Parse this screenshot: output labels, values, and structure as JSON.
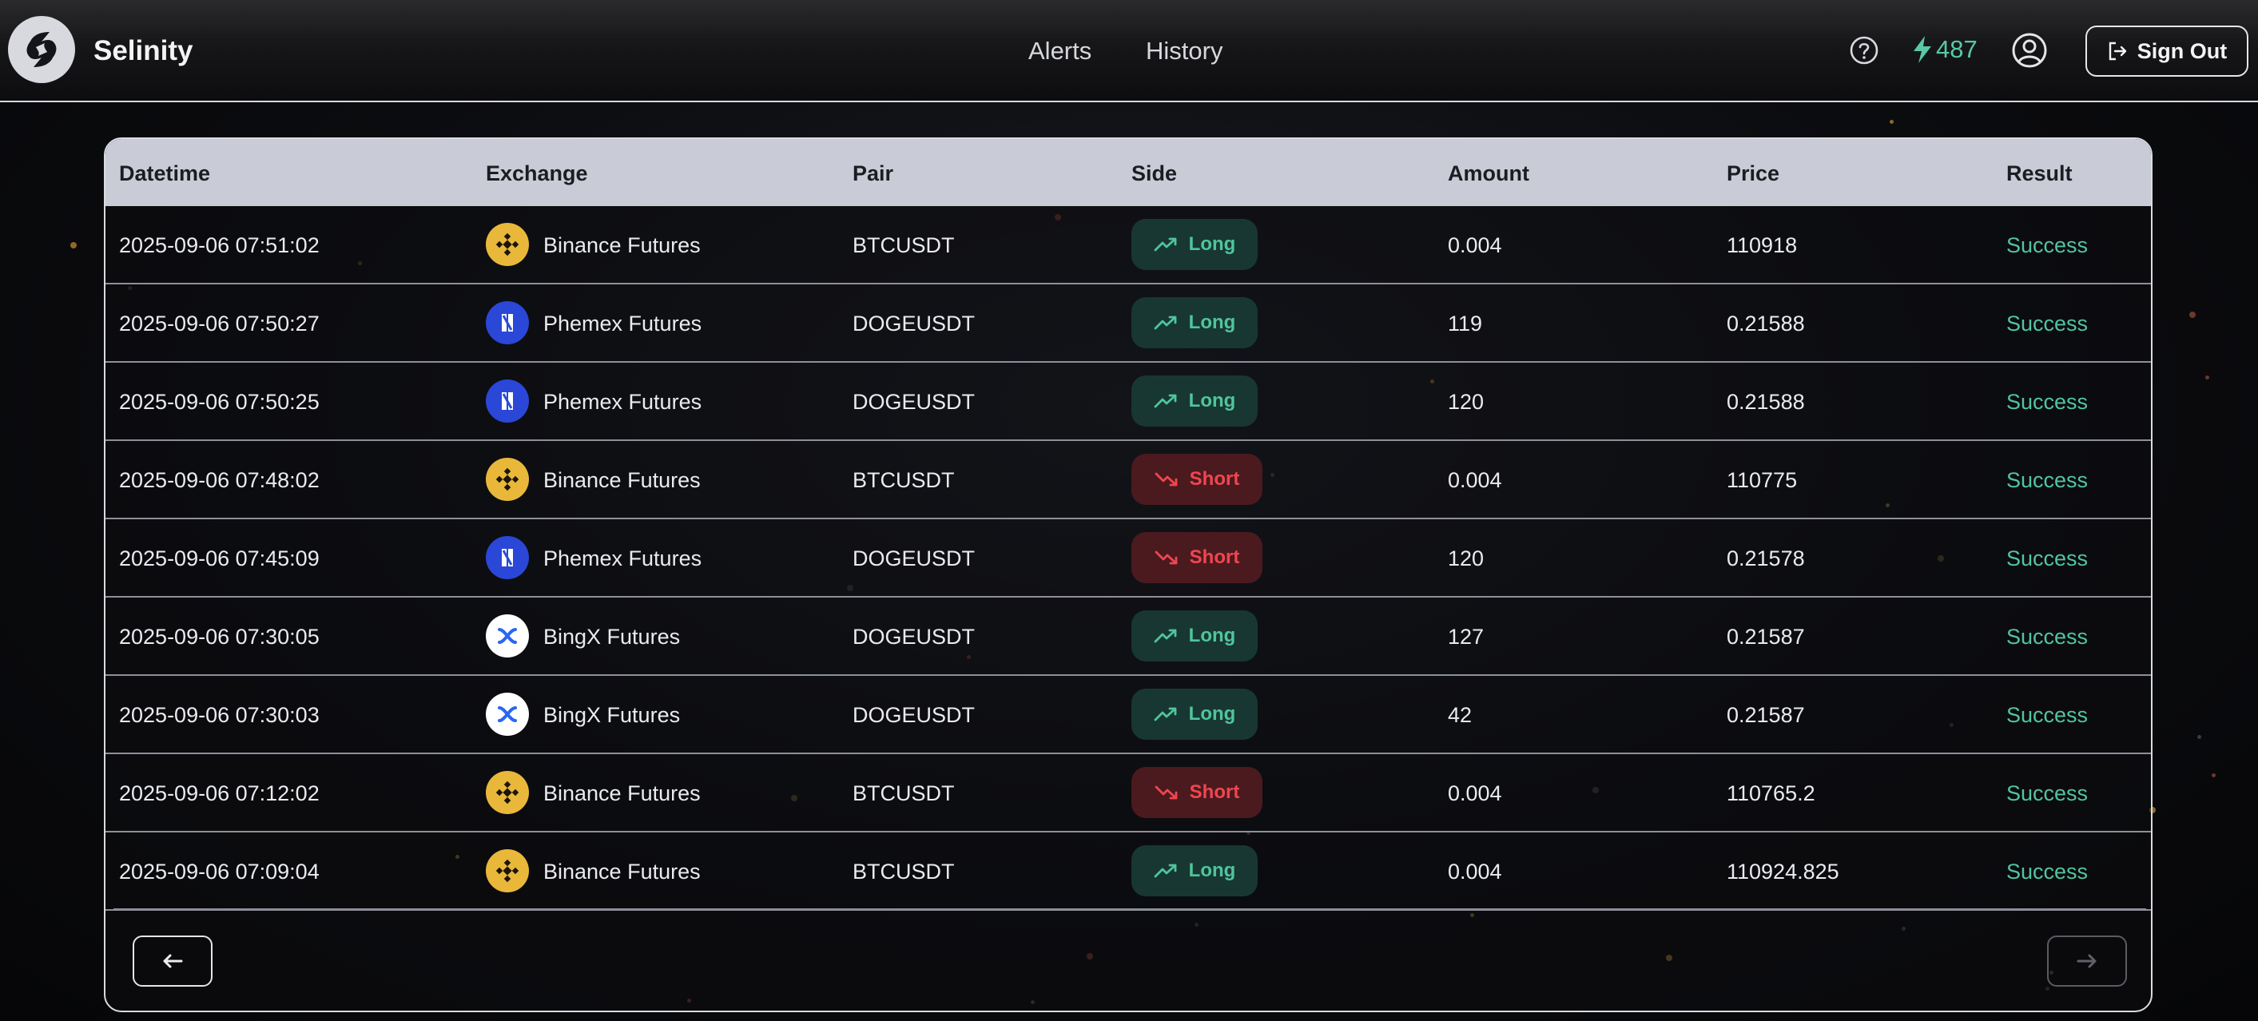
{
  "app": {
    "name": "Selinity"
  },
  "nav": {
    "alerts": "Alerts",
    "history": "History"
  },
  "header": {
    "credits": "487",
    "signout_label": "Sign Out"
  },
  "colors": {
    "accent": "#58c9a4",
    "long": "#4fc59c",
    "short": "#f0464f",
    "header_row": "#c9ccd6"
  },
  "table": {
    "columns": [
      "Datetime",
      "Exchange",
      "Pair",
      "Side",
      "Amount",
      "Price",
      "Result"
    ],
    "rows": [
      {
        "datetime": "2025-09-06 07:51:02",
        "exchange": "Binance Futures",
        "exchange_icon": "binance-icon",
        "pair": "BTCUSDT",
        "side": "Long",
        "amount": "0.004",
        "price": "110918",
        "result": "Success"
      },
      {
        "datetime": "2025-09-06 07:50:27",
        "exchange": "Phemex Futures",
        "exchange_icon": "phemex-icon",
        "pair": "DOGEUSDT",
        "side": "Long",
        "amount": "119",
        "price": "0.21588",
        "result": "Success"
      },
      {
        "datetime": "2025-09-06 07:50:25",
        "exchange": "Phemex Futures",
        "exchange_icon": "phemex-icon",
        "pair": "DOGEUSDT",
        "side": "Long",
        "amount": "120",
        "price": "0.21588",
        "result": "Success"
      },
      {
        "datetime": "2025-09-06 07:48:02",
        "exchange": "Binance Futures",
        "exchange_icon": "binance-icon",
        "pair": "BTCUSDT",
        "side": "Short",
        "amount": "0.004",
        "price": "110775",
        "result": "Success"
      },
      {
        "datetime": "2025-09-06 07:45:09",
        "exchange": "Phemex Futures",
        "exchange_icon": "phemex-icon",
        "pair": "DOGEUSDT",
        "side": "Short",
        "amount": "120",
        "price": "0.21578",
        "result": "Success"
      },
      {
        "datetime": "2025-09-06 07:30:05",
        "exchange": "BingX Futures",
        "exchange_icon": "bingx-icon",
        "pair": "DOGEUSDT",
        "side": "Long",
        "amount": "127",
        "price": "0.21587",
        "result": "Success"
      },
      {
        "datetime": "2025-09-06 07:30:03",
        "exchange": "BingX Futures",
        "exchange_icon": "bingx-icon",
        "pair": "DOGEUSDT",
        "side": "Long",
        "amount": "42",
        "price": "0.21587",
        "result": "Success"
      },
      {
        "datetime": "2025-09-06 07:12:02",
        "exchange": "Binance Futures",
        "exchange_icon": "binance-icon",
        "pair": "BTCUSDT",
        "side": "Short",
        "amount": "0.004",
        "price": "110765.2",
        "result": "Success"
      },
      {
        "datetime": "2025-09-06 07:09:04",
        "exchange": "Binance Futures",
        "exchange_icon": "binance-icon",
        "pair": "BTCUSDT",
        "side": "Long",
        "amount": "0.004",
        "price": "110924.825",
        "result": "Success"
      }
    ]
  },
  "pagination": {
    "prev_icon": "arrow-left-icon",
    "next_icon": "arrow-right-icon"
  }
}
